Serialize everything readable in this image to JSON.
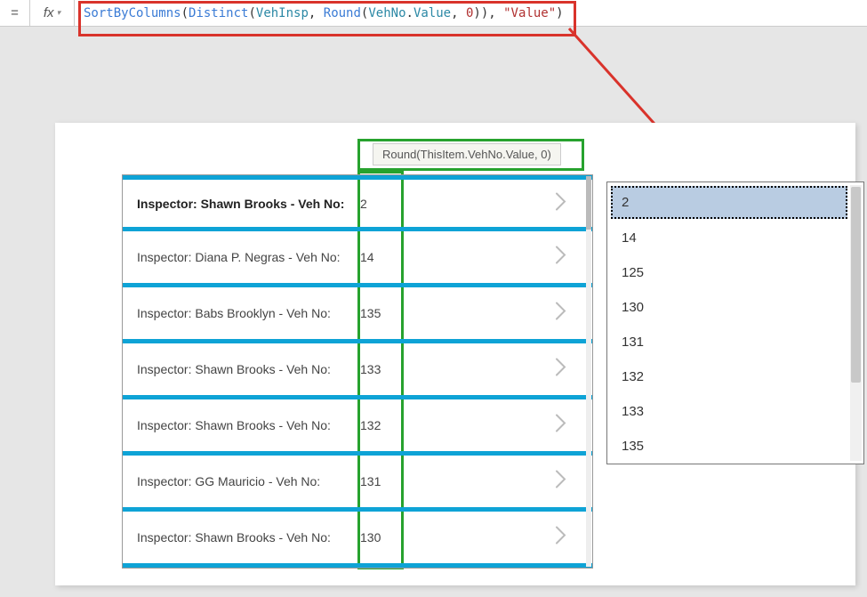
{
  "formula_bar": {
    "equals": "=",
    "fx": "fx",
    "tokens": {
      "sortby": "SortByColumns",
      "p1": "(",
      "distinct": "Distinct",
      "p2": "(",
      "vehinsp": "VehInsp",
      "c1": ", ",
      "round": "Round",
      "p3": "(",
      "vehno": "VehNo",
      "dot": ".",
      "value": "Value",
      "c2": ", ",
      "zero": "0",
      "p4": "))",
      "c3": ", ",
      "strval": "\"Value\"",
      "p5": ")"
    }
  },
  "column_tip": "Round(ThisItem.VehNo.Value, 0)",
  "gallery": {
    "rows": [
      {
        "label": "Inspector: Shawn Brooks - Veh No:",
        "num": "2",
        "selected": true
      },
      {
        "label": "Inspector: Diana P. Negras - Veh No:",
        "num": "14",
        "selected": false
      },
      {
        "label": "Inspector: Babs Brooklyn - Veh No:",
        "num": "135",
        "selected": false
      },
      {
        "label": "Inspector: Shawn Brooks - Veh No:",
        "num": "133",
        "selected": false
      },
      {
        "label": "Inspector: Shawn Brooks - Veh No:",
        "num": "132",
        "selected": false
      },
      {
        "label": "Inspector: GG Mauricio - Veh No:",
        "num": "131",
        "selected": false
      },
      {
        "label": "Inspector: Shawn Brooks - Veh No:",
        "num": "130",
        "selected": false
      }
    ]
  },
  "listbox": {
    "items": [
      "2",
      "14",
      "125",
      "130",
      "131",
      "132",
      "133",
      "135"
    ]
  }
}
